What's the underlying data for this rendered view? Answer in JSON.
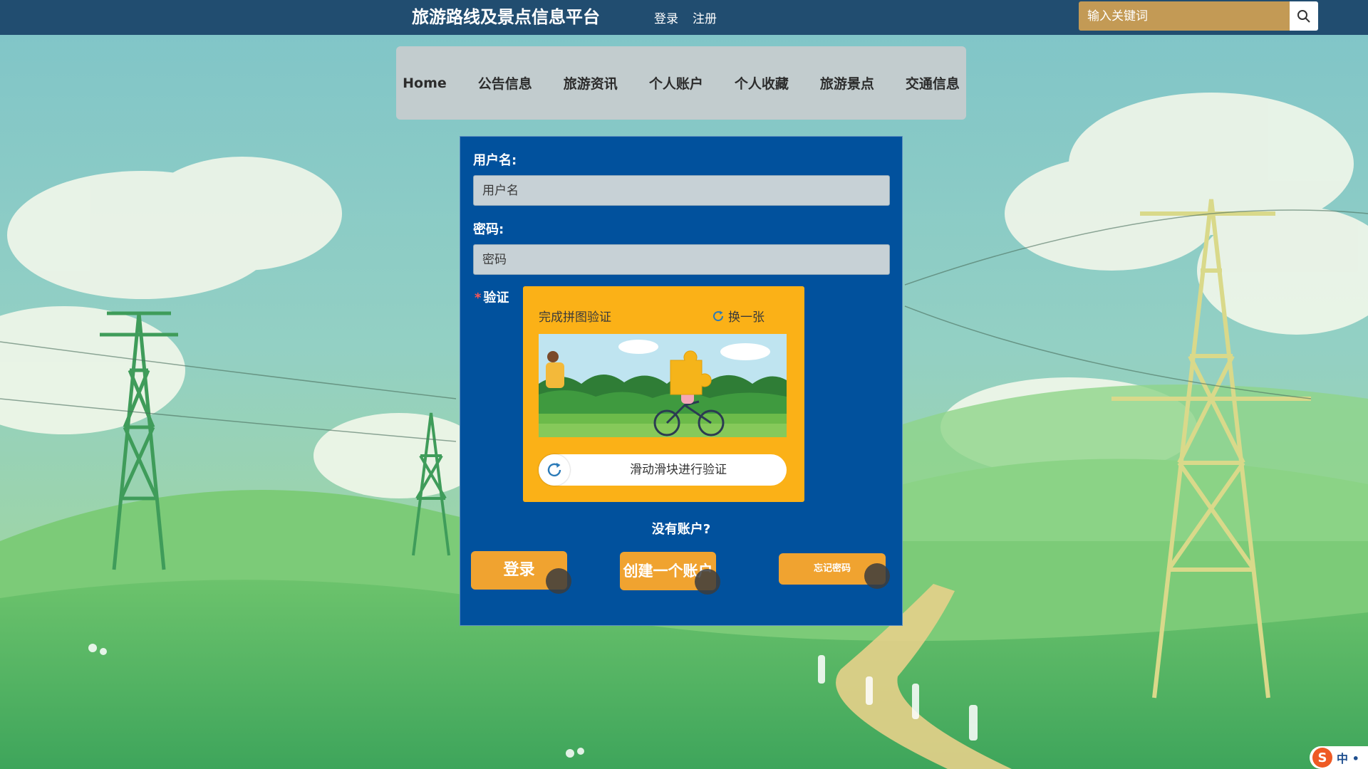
{
  "header": {
    "site_title": "旅游路线及景点信息平台",
    "login_link": "登录",
    "register_link": "注册",
    "search_placeholder": "输入关键词",
    "search_icon": "search-icon",
    "bar_color": "#214d70",
    "search_color": "#c39a55"
  },
  "nav": {
    "items": [
      {
        "label": "Home"
      },
      {
        "label": "公告信息"
      },
      {
        "label": "旅游资讯"
      },
      {
        "label": "个人账户"
      },
      {
        "label": "个人收藏"
      },
      {
        "label": "旅游景点"
      },
      {
        "label": "交通信息"
      }
    ]
  },
  "login_form": {
    "panel_color": "#01519d",
    "username_label": "用户名:",
    "username_placeholder": "用户名",
    "password_label": "密码:",
    "password_placeholder": "密码",
    "verify_required_mark": "*",
    "verify_label": "验证",
    "captcha": {
      "title": "完成拼图验证",
      "refresh_label": "换一张",
      "refresh_icon": "refresh-icon",
      "slider_text": "滑动滑块进行验证",
      "background_color": "#fbb117"
    },
    "no_account_text": "没有账户?",
    "login_button": "登录",
    "create_account_button": "创建一个账户",
    "forgot_password_button": "忘记密码",
    "button_color": "#f0a330"
  },
  "ime_indicator": {
    "logo": "S",
    "mode": "中 •"
  }
}
